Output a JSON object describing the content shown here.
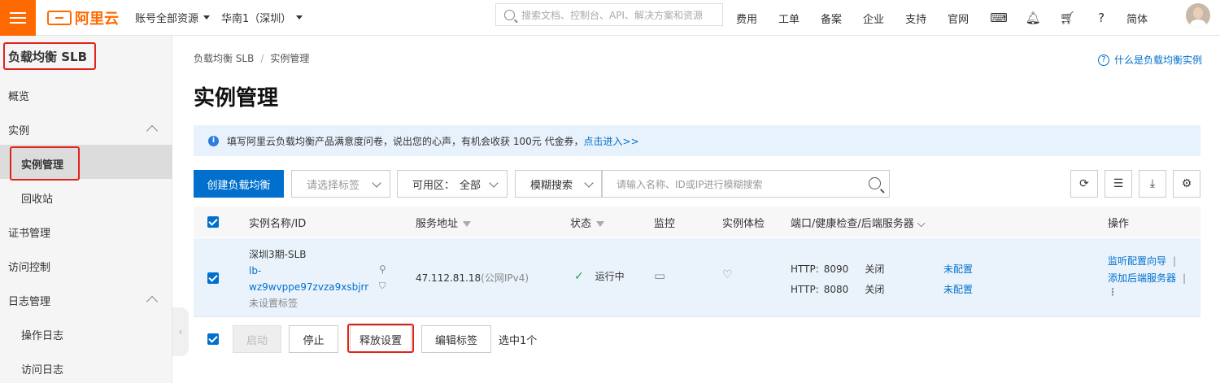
{
  "topbar": {
    "brand": "阿里云",
    "account_scope": "账号全部资源",
    "region": "华南1（深圳）",
    "search_placeholder": "搜索文档、控制台、API、解决方案和资源",
    "nav": [
      "费用",
      "工单",
      "备案",
      "企业",
      "支持",
      "官网"
    ],
    "language": "简体"
  },
  "sidebar": {
    "title": "负载均衡 SLB",
    "items": [
      "概览",
      "实例",
      "实例管理",
      "回收站",
      "证书管理",
      "访问控制",
      "日志管理",
      "操作日志",
      "访问日志"
    ]
  },
  "main": {
    "breadcrumb": [
      "负载均衡 SLB",
      "实例管理"
    ],
    "help_link": "什么是负载均衡实例",
    "title": "实例管理",
    "notice": {
      "text": "填写阿里云负载均衡产品满意度问卷，说出您的心声，有机会收获 100元 代金券，",
      "link": "点击进入>>"
    },
    "toolbar": {
      "create": "创建负载均衡",
      "tag_placeholder": "请选择标签",
      "zone_label": "可用区：",
      "zone_value": "全部",
      "search_mode": "模糊搜索",
      "search_placeholder": "请输入名称、ID或IP进行模糊搜索"
    },
    "table": {
      "headers": [
        "实例名称/ID",
        "服务地址",
        "状态",
        "监控",
        "实例体检",
        "端口/健康检查/后端服务器",
        "操作"
      ],
      "row": {
        "name": "深圳3期-SLB",
        "id_line1": "lb-",
        "id_line2": "wz9wvppe97zvza9xsbjrr",
        "tag": "未设置标签",
        "address": "47.112.81.18",
        "address_type": "(公网IPv4)",
        "status": "运行中",
        "listeners": [
          {
            "proto": "HTTP:",
            "port": "8090",
            "health": "关闭",
            "backend": "未配置"
          },
          {
            "proto": "HTTP:",
            "port": "8080",
            "health": "关闭",
            "backend": "未配置"
          }
        ],
        "actions": [
          "监听配置向导",
          "添加后端服务器"
        ]
      }
    },
    "bulk": {
      "start": "启动",
      "stop": "停止",
      "release": "释放设置",
      "edit_tags": "编辑标签",
      "selected": "选中1个"
    }
  },
  "colors": {
    "accent": "#ff6a00",
    "primary": "#0070cc",
    "highlight": "#e2231a"
  }
}
